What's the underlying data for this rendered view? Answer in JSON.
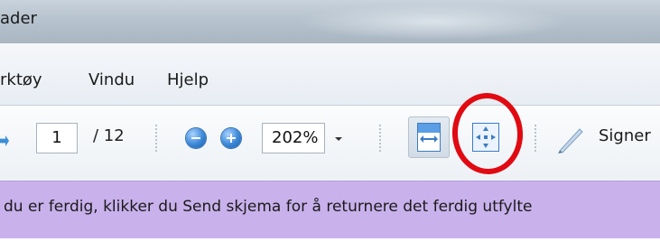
{
  "window": {
    "title": "ader"
  },
  "menu": {
    "items": [
      "rktøy",
      "Vindu",
      "Hjelp"
    ]
  },
  "toolbar": {
    "page_current": "1",
    "page_total": "/ 12",
    "zoom_value": "202%",
    "zoom_out_icon": "zoom-out-icon",
    "zoom_in_icon": "zoom-in-icon",
    "fit_width_icon": "fit-width-icon",
    "fit_page_icon": "fit-page-icon",
    "sign_icon": "pen-icon",
    "sign_label": "Signer"
  },
  "annotation": {
    "highlight_color": "#e10a12"
  },
  "notice": {
    "text": "du er ferdig, klikker du Send skjema for å returnere det ferdig utfylte"
  },
  "colors": {
    "notice_bg": "#c9b1ec",
    "accent_blue": "#3a86d6"
  }
}
